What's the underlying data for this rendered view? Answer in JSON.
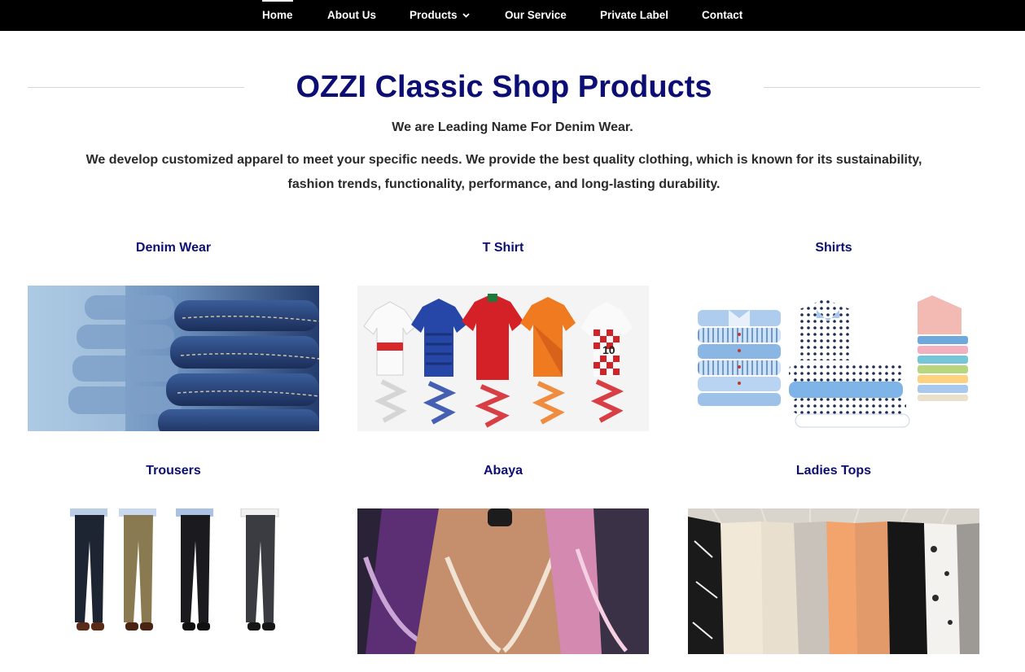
{
  "nav": {
    "items": [
      {
        "label": "Home"
      },
      {
        "label": "About Us"
      },
      {
        "label": "Products"
      },
      {
        "label": "Our Service"
      },
      {
        "label": "Private Label"
      },
      {
        "label": "Contact"
      }
    ],
    "active": "Home"
  },
  "header": {
    "title": "OZZI Classic Shop Products",
    "tagline": "We are Leading Name For Denim Wear.",
    "intro_line1": "We develop customized apparel to meet your specific needs. We provide the best quality clothing, which is known for its sustainability,",
    "intro_line2": "fashion trends, functionality, performance, and long-lasting durability."
  },
  "products": [
    {
      "title": "Denim Wear"
    },
    {
      "title": "T Shirt",
      "jersey_number": "10"
    },
    {
      "title": "Shirts"
    },
    {
      "title": "Trousers"
    },
    {
      "title": "Abaya"
    },
    {
      "title": "Ladies Tops"
    }
  ],
  "colors": {
    "nav_bg": "#000000",
    "accent": "#0c0e74",
    "body_text": "#2a2a2a"
  }
}
